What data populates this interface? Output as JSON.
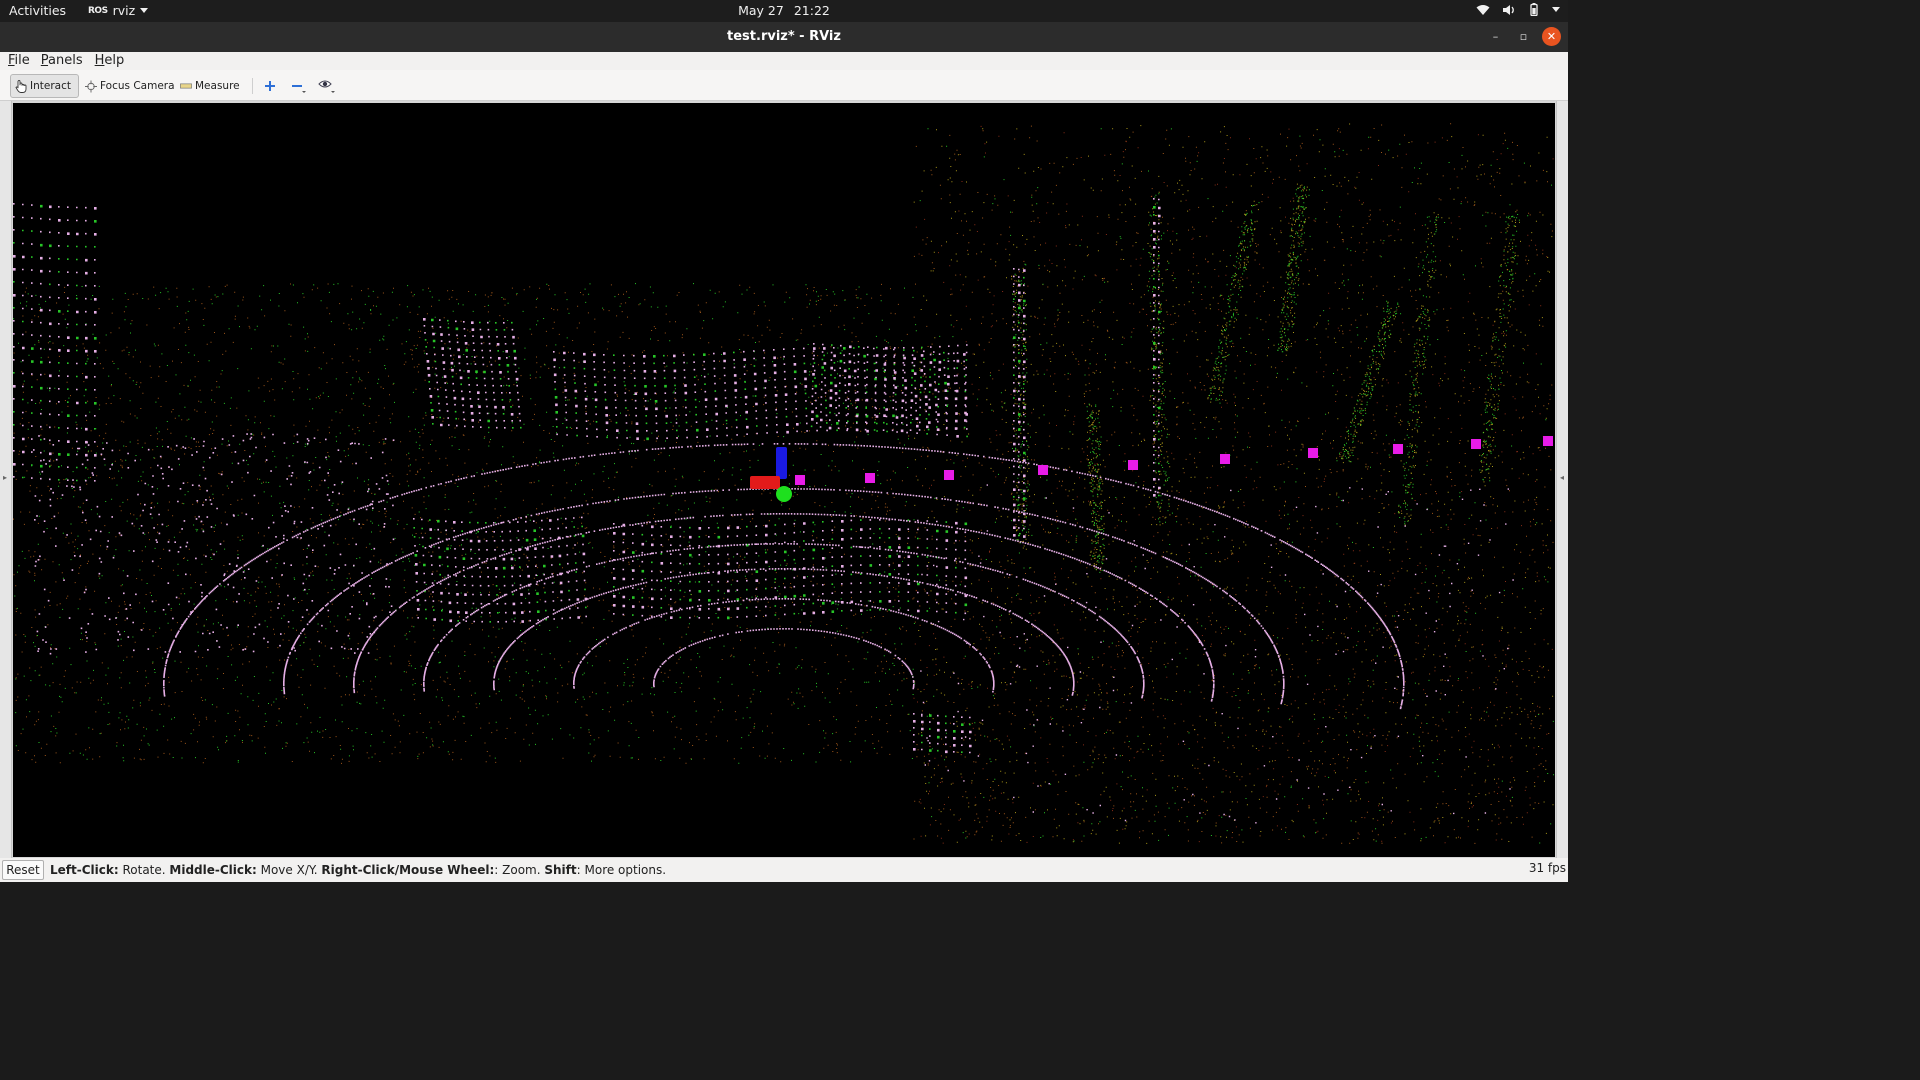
{
  "topbar": {
    "activities": "Activities",
    "app_logo": "ROS",
    "app_name": "rviz",
    "date": "May 27",
    "time": "21:22",
    "tray_icons": [
      "wifi-icon",
      "volume-icon",
      "battery-icon",
      "power-menu-icon"
    ]
  },
  "window": {
    "title": "test.rviz* - RViz",
    "controls": [
      "minimize",
      "maximize",
      "close"
    ]
  },
  "menubar": {
    "items": [
      {
        "label": "File",
        "mnemonic": "F"
      },
      {
        "label": "Panels",
        "mnemonic": "P"
      },
      {
        "label": "Help",
        "mnemonic": "H"
      }
    ]
  },
  "toolbar": {
    "interact_label": "Interact",
    "focus_camera_label": "Focus Camera",
    "measure_label": "Measure",
    "extra_tools": [
      "add-tool-icon",
      "remove-tool-icon",
      "camera-view-icon"
    ]
  },
  "statusbar": {
    "reset_label": "Reset",
    "help_segments": [
      {
        "bold": "Left-Click:",
        "text": " Rotate. "
      },
      {
        "bold": "Middle-Click:",
        "text": " Move X/Y. "
      },
      {
        "bold": "Right-Click/Mouse Wheel:",
        "text": ": Zoom. "
      },
      {
        "bold": "Shift",
        "text": ": More options."
      }
    ],
    "fps": "31 fps"
  },
  "colors": {
    "close_button": "#e95420",
    "render_background": "#000000",
    "point_pink": "#f2b8f2",
    "point_green": "#2ee82e",
    "point_orange": "#b8651f",
    "point_yellow": "#c8b21f",
    "waypoint_magenta": "#e81ce8",
    "axis_x": "#e21a1a",
    "axis_y": "#1ee01e",
    "axis_z": "#1a1ae2"
  }
}
